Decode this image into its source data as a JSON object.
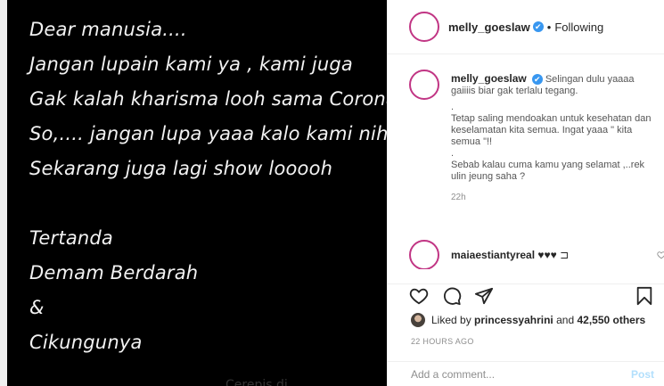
{
  "post_image": {
    "lines": [
      "Dear manusia....",
      "Jangan lupain kami ya , kami juga",
      "Gak kalah kharisma looh sama Corona",
      "So,.... jangan lupa yaaa kalo kami nih",
      "Sekarang juga lagi show looooh",
      "",
      "Tertanda",
      "Demam Berdarah",
      "&",
      "Cikungunya"
    ],
    "watermark": "Cerepis di"
  },
  "header": {
    "username": "melly_goeslaw",
    "verified_icon": "✔",
    "separator": "•",
    "follow_status": "Following"
  },
  "caption": {
    "username": "melly_goeslaw",
    "text_first": "Selingan dulu yaaaa gaiiiis biar gak terlalu tegang.",
    "lines": [
      ".",
      "Tetap saling mendoakan untuk kesehatan dan keselamatan kita semua. Ingat yaaa \" kita semua \"!!",
      ".",
      "Sebab kalau cuma kamu yang selamat ,..rek ulin jeung saha ?"
    ],
    "time": "22h"
  },
  "comment": {
    "username": "maiaestiantyreal",
    "text": "♥♥♥ ⊐"
  },
  "likes": {
    "prefix": "Liked by",
    "user": "princessyahrini",
    "and": "and",
    "count": "42,550 others"
  },
  "post_time": "22 HOURS AGO",
  "add_comment": {
    "placeholder": "Add a comment...",
    "post_label": "Post"
  },
  "colors": {
    "verified": "#3897f0",
    "story_ring": "#c13584",
    "post_button": "#b2dffc"
  }
}
